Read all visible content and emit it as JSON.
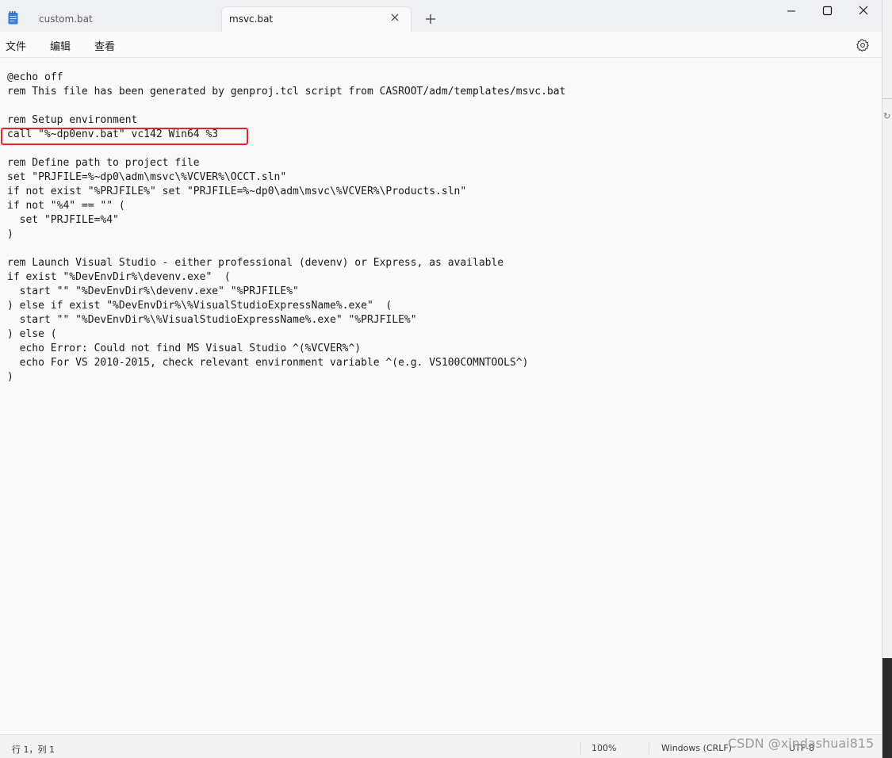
{
  "tabs": [
    {
      "label": "custom.bat"
    },
    {
      "label": "msvc.bat"
    }
  ],
  "menu": {
    "file": "文件",
    "edit": "编辑",
    "view": "查看"
  },
  "editor": {
    "lines": [
      "@echo off",
      "rem This file has been generated by genproj.tcl script from CASROOT/adm/templates/msvc.bat",
      "",
      "rem Setup environment",
      "call \"%~dp0env.bat\" vc142 Win64 %3",
      "",
      "rem Define path to project file",
      "set \"PRJFILE=%~dp0\\adm\\msvc\\%VCVER%\\OCCT.sln\"",
      "if not exist \"%PRJFILE%\" set \"PRJFILE=%~dp0\\adm\\msvc\\%VCVER%\\Products.sln\"",
      "if not \"%4\" == \"\" (",
      "  set \"PRJFILE=%4\"",
      ")",
      "",
      "rem Launch Visual Studio - either professional (devenv) or Express, as available",
      "if exist \"%DevEnvDir%\\devenv.exe\"  (",
      "  start \"\" \"%DevEnvDir%\\devenv.exe\" \"%PRJFILE%\"",
      ") else if exist \"%DevEnvDir%\\%VisualStudioExpressName%.exe\"  (",
      "  start \"\" \"%DevEnvDir%\\%VisualStudioExpressName%.exe\" \"%PRJFILE%\"",
      ") else (",
      "  echo Error: Could not find MS Visual Studio ^(%VCVER%^)",
      "  echo For VS 2010-2015, check relevant environment variable ^(e.g. VS100COMNTOOLS^)",
      ")"
    ]
  },
  "status": {
    "position": "行 1，列 1",
    "zoom": "100%",
    "line_ending": "Windows (CRLF)",
    "encoding": "UTF-8"
  },
  "watermark": "CSDN @xindashuai815",
  "colors": {
    "highlight_box": "#e8232a",
    "accent_icon": "#2b6cd9"
  }
}
